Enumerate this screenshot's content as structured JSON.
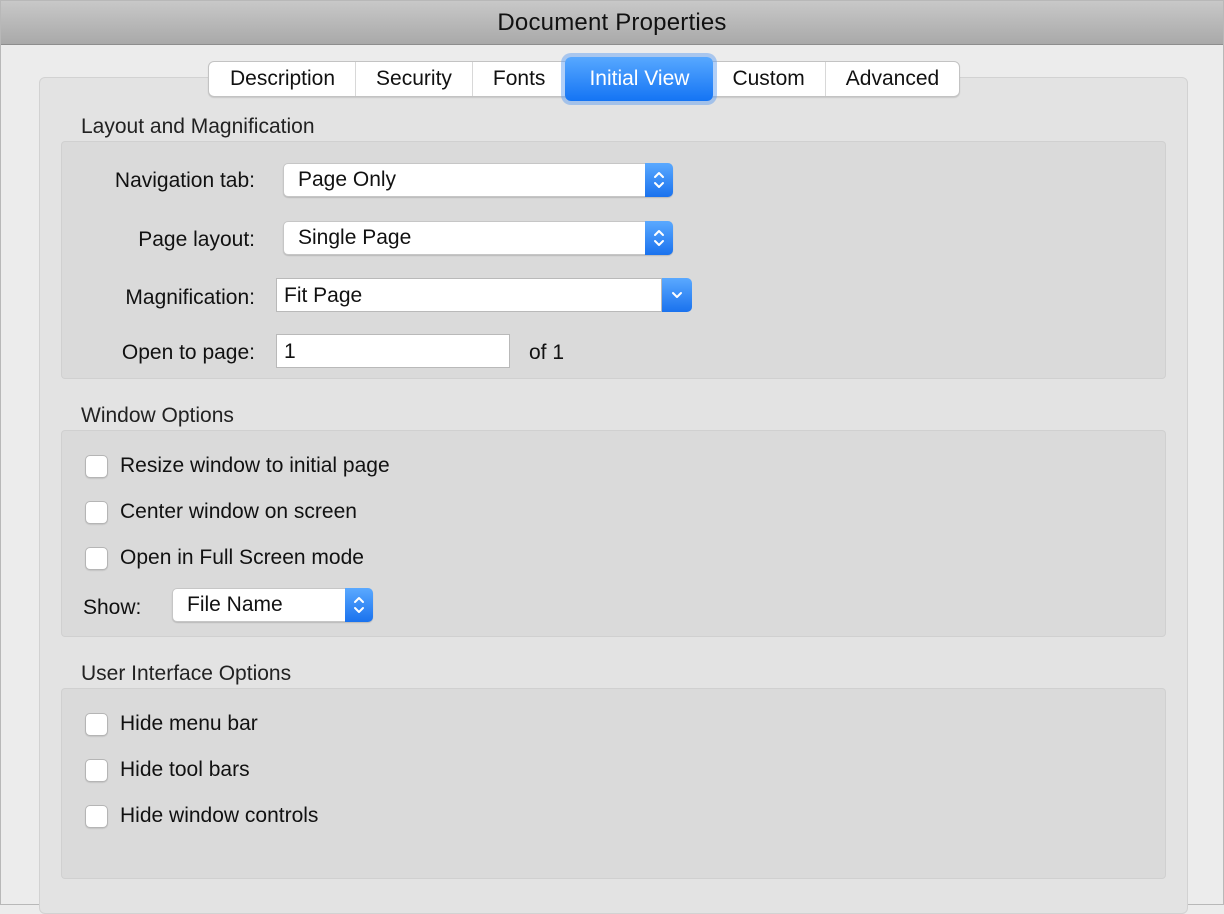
{
  "window": {
    "title": "Document Properties"
  },
  "tabs": [
    {
      "label": "Description",
      "active": false
    },
    {
      "label": "Security",
      "active": false
    },
    {
      "label": "Fonts",
      "active": false
    },
    {
      "label": "Initial View",
      "active": true
    },
    {
      "label": "Custom",
      "active": false
    },
    {
      "label": "Advanced",
      "active": false
    }
  ],
  "layout_magnification": {
    "heading": "Layout and Magnification",
    "navigation_tab": {
      "label": "Navigation tab:",
      "value": "Page Only",
      "icon": "up-down-chevron-icon"
    },
    "page_layout": {
      "label": "Page layout:",
      "value": "Single Page",
      "icon": "up-down-chevron-icon"
    },
    "magnification": {
      "label": "Magnification:",
      "value": "Fit Page",
      "icon": "chevron-down-icon"
    },
    "open_to_page": {
      "label": "Open to page:",
      "value": "1",
      "of_label": "of 1"
    }
  },
  "window_options": {
    "heading": "Window Options",
    "checkboxes": [
      {
        "label": "Resize window to initial page",
        "checked": false
      },
      {
        "label": "Center window on screen",
        "checked": false
      },
      {
        "label": "Open in Full Screen mode",
        "checked": false
      }
    ],
    "show": {
      "label": "Show:",
      "value": "File Name",
      "icon": "up-down-chevron-icon"
    }
  },
  "ui_options": {
    "heading": "User Interface Options",
    "checkboxes": [
      {
        "label": "Hide menu bar",
        "checked": false
      },
      {
        "label": "Hide tool bars",
        "checked": false
      },
      {
        "label": "Hide window controls",
        "checked": false
      }
    ]
  },
  "colors": {
    "accent": "#1474f4",
    "accent_light": "#57a8ff"
  }
}
